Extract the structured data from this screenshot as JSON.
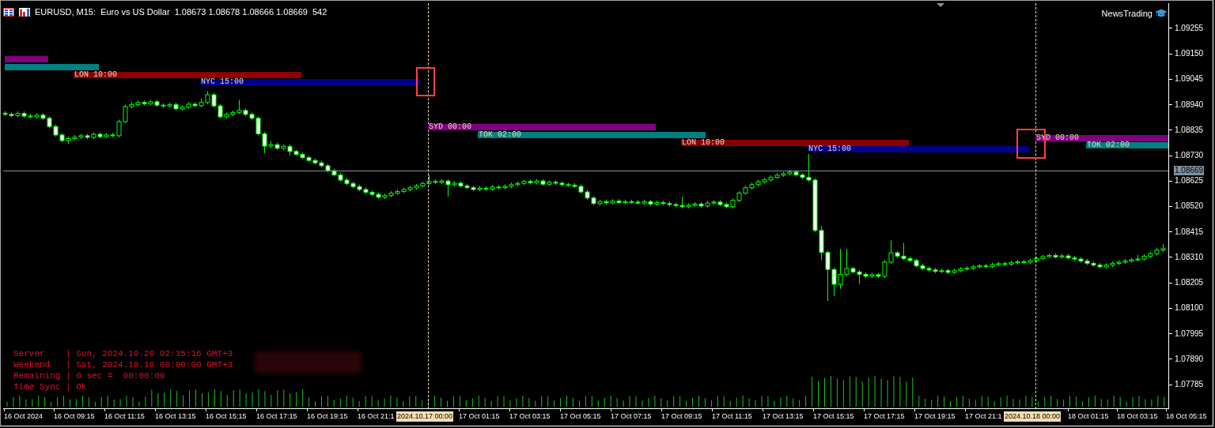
{
  "window": {
    "title": "EURUSD, M15:  Euro vs US Dollar  1.08673 1.08678 1.08666 1.08669  542"
  },
  "indicator": {
    "label": "NewsTrading"
  },
  "chart": {
    "chart_data": {
      "type": "candlestick",
      "ylim": [
        1.07684,
        1.09359
      ],
      "yticks": [
        {
          "value": 1.09255,
          "label": "1.09255"
        },
        {
          "value": 1.0915,
          "label": "1.09150"
        },
        {
          "value": 1.09045,
          "label": "1.09045"
        },
        {
          "value": 1.0894,
          "label": "1.08940"
        },
        {
          "value": 1.08835,
          "label": "1.08835"
        },
        {
          "value": 1.0873,
          "label": "1.08730"
        },
        {
          "value": 1.08625,
          "label": "1.08625"
        },
        {
          "value": 1.0852,
          "label": "1.08520"
        },
        {
          "value": 1.08415,
          "label": "1.08415"
        },
        {
          "value": 1.0831,
          "label": "1.08310"
        },
        {
          "value": 1.08205,
          "label": "1.08205"
        },
        {
          "value": 1.081,
          "label": "1.08100"
        },
        {
          "value": 1.07995,
          "label": "1.07995"
        },
        {
          "value": 1.0789,
          "label": "1.07890"
        },
        {
          "value": 1.07785,
          "label": "1.07785"
        }
      ],
      "categories": [
        null,
        null,
        null,
        null,
        null,
        null,
        null,
        null,
        null,
        null,
        null,
        null,
        null,
        null,
        null,
        null,
        null,
        null,
        null,
        null,
        null,
        null,
        null,
        null,
        null,
        null,
        null,
        null,
        null,
        null,
        null,
        null,
        null,
        null,
        null,
        null,
        null,
        null,
        null,
        null,
        null,
        null,
        null,
        null,
        null,
        null,
        null,
        null,
        null,
        null,
        null,
        null,
        null,
        null,
        null,
        null,
        null,
        null,
        null,
        null,
        null,
        null,
        null,
        null,
        null,
        null,
        null,
        null,
        null,
        null,
        null,
        null,
        null,
        null,
        null,
        null,
        null,
        null,
        null,
        null,
        null,
        null,
        null,
        null,
        null,
        null,
        null,
        null,
        null,
        null,
        null,
        null,
        null,
        null,
        null,
        null,
        null,
        null,
        null,
        null,
        null,
        null,
        null,
        null,
        null,
        null,
        null,
        null,
        null,
        null,
        null,
        null,
        null,
        null,
        null,
        null,
        null,
        null,
        null,
        null,
        null,
        null,
        null,
        null,
        null,
        null,
        null,
        null,
        null,
        null,
        null,
        null,
        null,
        null,
        null,
        null,
        null,
        null,
        null,
        null,
        null,
        null,
        null,
        null,
        null,
        null,
        null,
        null,
        null,
        null,
        null,
        null,
        null,
        null,
        null,
        null,
        null,
        null,
        null,
        null,
        null,
        null,
        null,
        null,
        null,
        null,
        null,
        null,
        null,
        null,
        null,
        null,
        null,
        null,
        null,
        null,
        null,
        null,
        null,
        null,
        null,
        null,
        null,
        null
      ],
      "ohlc": [
        [
          1.08905,
          1.08913,
          1.08893,
          1.089
        ],
        [
          1.089,
          1.08908,
          1.08888,
          1.08895
        ],
        [
          1.08895,
          1.08912,
          1.08888,
          1.08904
        ],
        [
          1.08904,
          1.08912,
          1.08886,
          1.08893
        ],
        [
          1.08893,
          1.08901,
          1.08883,
          1.0889
        ],
        [
          1.0889,
          1.08905,
          1.08883,
          1.08897
        ],
        [
          1.08897,
          1.08905,
          1.08877,
          1.08884
        ],
        [
          1.08884,
          1.08892,
          1.08843,
          1.0885
        ],
        [
          1.0885,
          1.08858,
          1.08808,
          1.08815
        ],
        [
          1.08815,
          1.08823,
          1.08785,
          1.08792
        ],
        [
          1.08792,
          1.08808,
          1.08778,
          1.088
        ],
        [
          1.088,
          1.08814,
          1.08793,
          1.08806
        ],
        [
          1.08806,
          1.0882,
          1.08799,
          1.08812
        ],
        [
          1.08812,
          1.0882,
          1.08798,
          1.08805
        ],
        [
          1.08805,
          1.08826,
          1.08798,
          1.08818
        ],
        [
          1.08818,
          1.08826,
          1.08801,
          1.08808
        ],
        [
          1.08808,
          1.08823,
          1.08801,
          1.08815
        ],
        [
          1.08815,
          1.08823,
          1.08805,
          1.08812
        ],
        [
          1.08812,
          1.08878,
          1.08805,
          1.0887
        ],
        [
          1.0887,
          1.0894,
          1.08863,
          1.08932
        ],
        [
          1.08932,
          1.08952,
          1.08925,
          1.0894
        ],
        [
          1.0894,
          1.08957,
          1.08933,
          1.08949
        ],
        [
          1.08949,
          1.08957,
          1.08937,
          1.08944
        ],
        [
          1.08944,
          1.0896,
          1.08937,
          1.08952
        ],
        [
          1.08952,
          1.0896,
          1.08931,
          1.08938
        ],
        [
          1.08938,
          1.08946,
          1.08928,
          1.08935
        ],
        [
          1.08935,
          1.08948,
          1.08928,
          1.0894
        ],
        [
          1.0894,
          1.08948,
          1.08916,
          1.08923
        ],
        [
          1.08923,
          1.08938,
          1.08916,
          1.0893
        ],
        [
          1.0893,
          1.0895,
          1.08923,
          1.08942
        ],
        [
          1.08942,
          1.0895,
          1.08929,
          1.08936
        ],
        [
          1.08936,
          1.08965,
          1.08929,
          1.08949
        ],
        [
          1.08949,
          1.08995,
          1.08942,
          1.08981
        ],
        [
          1.08981,
          1.08989,
          1.08928,
          1.08935
        ],
        [
          1.08935,
          1.08943,
          1.08883,
          1.0889
        ],
        [
          1.0889,
          1.08908,
          1.08883,
          1.089
        ],
        [
          1.089,
          1.08916,
          1.08893,
          1.08908
        ],
        [
          1.08908,
          1.0896,
          1.08901,
          1.08916
        ],
        [
          1.08916,
          1.08924,
          1.08893,
          1.089
        ],
        [
          1.089,
          1.08908,
          1.08877,
          1.08884
        ],
        [
          1.08884,
          1.08892,
          1.08813,
          1.0882
        ],
        [
          1.0882,
          1.08828,
          1.0874,
          1.08769
        ],
        [
          1.08769,
          1.0879,
          1.0876,
          1.08775
        ],
        [
          1.08775,
          1.08783,
          1.08753,
          1.0876
        ],
        [
          1.0876,
          1.08776,
          1.08753,
          1.08768
        ],
        [
          1.08768,
          1.08776,
          1.0873,
          1.08747
        ],
        [
          1.08747,
          1.08755,
          1.08728,
          1.08735
        ],
        [
          1.08735,
          1.08743,
          1.08715,
          1.08722
        ],
        [
          1.08722,
          1.0873,
          1.08703,
          1.0871
        ],
        [
          1.0871,
          1.08718,
          1.08693,
          1.087
        ],
        [
          1.087,
          1.08708,
          1.08681,
          1.08688
        ],
        [
          1.08688,
          1.08696,
          1.08661,
          1.08668
        ],
        [
          1.08668,
          1.08676,
          1.08643,
          1.0865
        ],
        [
          1.0865,
          1.08658,
          1.08622,
          1.08629
        ],
        [
          1.08629,
          1.08637,
          1.08608,
          1.08615
        ],
        [
          1.08615,
          1.08623,
          1.08595,
          1.08602
        ],
        [
          1.08602,
          1.0861,
          1.08583,
          1.0859
        ],
        [
          1.0859,
          1.08598,
          1.08571,
          1.08578
        ],
        [
          1.08578,
          1.08586,
          1.08563,
          1.0857
        ],
        [
          1.0857,
          1.08578,
          1.08551,
          1.08558
        ],
        [
          1.08558,
          1.08573,
          1.08551,
          1.08565
        ],
        [
          1.08565,
          1.08583,
          1.08558,
          1.08575
        ],
        [
          1.08575,
          1.0859,
          1.08568,
          1.08582
        ],
        [
          1.08582,
          1.08598,
          1.08575,
          1.0859
        ],
        [
          1.0859,
          1.08605,
          1.08583,
          1.08597
        ],
        [
          1.08597,
          1.08613,
          1.0859,
          1.08605
        ],
        [
          1.08605,
          1.08623,
          1.08598,
          1.08615
        ],
        [
          1.08615,
          1.0865,
          1.08608,
          1.08623
        ],
        [
          1.08623,
          1.08631,
          1.08613,
          1.0862
        ],
        [
          1.0862,
          1.08633,
          1.08613,
          1.08625
        ],
        [
          1.08625,
          1.08633,
          1.0856,
          1.0861
        ],
        [
          1.0861,
          1.08624,
          1.08603,
          1.08616
        ],
        [
          1.08616,
          1.08624,
          1.08598,
          1.08605
        ],
        [
          1.08605,
          1.08613,
          1.08591,
          1.08598
        ],
        [
          1.08598,
          1.08606,
          1.08583,
          1.0859
        ],
        [
          1.0859,
          1.08603,
          1.08583,
          1.08595
        ],
        [
          1.08595,
          1.08603,
          1.08585,
          1.08592
        ],
        [
          1.08592,
          1.08608,
          1.08585,
          1.086
        ],
        [
          1.086,
          1.08608,
          1.08591,
          1.08598
        ],
        [
          1.08598,
          1.08611,
          1.08591,
          1.08603
        ],
        [
          1.08603,
          1.08618,
          1.08596,
          1.0861
        ],
        [
          1.0861,
          1.08623,
          1.08603,
          1.08615
        ],
        [
          1.08615,
          1.08631,
          1.08608,
          1.08623
        ],
        [
          1.08623,
          1.08631,
          1.08611,
          1.08618
        ],
        [
          1.08618,
          1.08633,
          1.08611,
          1.08625
        ],
        [
          1.08625,
          1.08633,
          1.08605,
          1.08612
        ],
        [
          1.08612,
          1.08628,
          1.08605,
          1.0862
        ],
        [
          1.0862,
          1.08628,
          1.08609,
          1.08616
        ],
        [
          1.08616,
          1.08624,
          1.08603,
          1.0861
        ],
        [
          1.0861,
          1.08618,
          1.08601,
          1.08608
        ],
        [
          1.08608,
          1.08616,
          1.08596,
          1.08603
        ],
        [
          1.08603,
          1.08611,
          1.08573,
          1.0858
        ],
        [
          1.0858,
          1.08588,
          1.08548,
          1.08555
        ],
        [
          1.08555,
          1.08563,
          1.08525,
          1.08532
        ],
        [
          1.08532,
          1.08548,
          1.08525,
          1.0854
        ],
        [
          1.0854,
          1.08548,
          1.08528,
          1.08535
        ],
        [
          1.08535,
          1.0855,
          1.08528,
          1.08542
        ],
        [
          1.08542,
          1.0855,
          1.08529,
          1.08536
        ],
        [
          1.08536,
          1.08548,
          1.08529,
          1.0854
        ],
        [
          1.0854,
          1.08548,
          1.08531,
          1.08538
        ],
        [
          1.08538,
          1.08546,
          1.08527,
          1.08534
        ],
        [
          1.08534,
          1.08548,
          1.08527,
          1.0854
        ],
        [
          1.0854,
          1.08548,
          1.08523,
          1.0853
        ],
        [
          1.0853,
          1.08544,
          1.08523,
          1.08536
        ],
        [
          1.08536,
          1.08544,
          1.08525,
          1.08532
        ],
        [
          1.08532,
          1.0854,
          1.08521,
          1.08528
        ],
        [
          1.08528,
          1.08536,
          1.08517,
          1.08524
        ],
        [
          1.08524,
          1.0856,
          1.08512,
          1.08519
        ],
        [
          1.08519,
          1.08533,
          1.08512,
          1.08525
        ],
        [
          1.08525,
          1.08538,
          1.08518,
          1.0853
        ],
        [
          1.0853,
          1.08538,
          1.08515,
          1.08522
        ],
        [
          1.08522,
          1.08542,
          1.08515,
          1.08534
        ],
        [
          1.08534,
          1.08546,
          1.08527,
          1.08538
        ],
        [
          1.08538,
          1.08546,
          1.08521,
          1.08528
        ],
        [
          1.08528,
          1.08536,
          1.08512,
          1.08519
        ],
        [
          1.08519,
          1.08553,
          1.08512,
          1.08545
        ],
        [
          1.08545,
          1.08583,
          1.08538,
          1.08575
        ],
        [
          1.08575,
          1.08605,
          1.08568,
          1.08597
        ],
        [
          1.08597,
          1.08618,
          1.0859,
          1.0861
        ],
        [
          1.0861,
          1.0863,
          1.08603,
          1.08622
        ],
        [
          1.08622,
          1.08638,
          1.08615,
          1.0863
        ],
        [
          1.0863,
          1.08648,
          1.08623,
          1.0864
        ],
        [
          1.0864,
          1.08657,
          1.08633,
          1.08649
        ],
        [
          1.08649,
          1.08663,
          1.08642,
          1.08655
        ],
        [
          1.08655,
          1.0867,
          1.08648,
          1.08662
        ],
        [
          1.08662,
          1.0867,
          1.08643,
          1.0865
        ],
        [
          1.0865,
          1.08658,
          1.08633,
          1.0864
        ],
        [
          1.0864,
          1.08737,
          1.08622,
          1.08629
        ],
        [
          1.08629,
          1.08637,
          1.08414,
          1.08421
        ],
        [
          1.08421,
          1.0844,
          1.083,
          1.0833
        ],
        [
          1.0833,
          1.08338,
          1.0813,
          1.0826
        ],
        [
          1.0826,
          1.08268,
          1.0815,
          1.08199
        ],
        [
          1.08199,
          1.08345,
          1.0818,
          1.0824
        ],
        [
          1.0824,
          1.08345,
          1.0823,
          1.08264
        ],
        [
          1.08264,
          1.08272,
          1.08243,
          1.0825
        ],
        [
          1.0825,
          1.08258,
          1.082,
          1.0824
        ],
        [
          1.0824,
          1.08248,
          1.08225,
          1.08232
        ],
        [
          1.08232,
          1.08246,
          1.08225,
          1.08238
        ],
        [
          1.08238,
          1.08246,
          1.08225,
          1.08232
        ],
        [
          1.08232,
          1.08298,
          1.08225,
          1.0829
        ],
        [
          1.0829,
          1.0838,
          1.08283,
          1.08329
        ],
        [
          1.08329,
          1.08337,
          1.08308,
          1.08315
        ],
        [
          1.08315,
          1.0837,
          1.08298,
          1.08305
        ],
        [
          1.08305,
          1.08313,
          1.0829,
          1.08297
        ],
        [
          1.08297,
          1.08305,
          1.08268,
          1.08275
        ],
        [
          1.08275,
          1.08283,
          1.08257,
          1.08264
        ],
        [
          1.08264,
          1.08272,
          1.08251,
          1.08258
        ],
        [
          1.08258,
          1.08266,
          1.08245,
          1.08252
        ],
        [
          1.08252,
          1.08263,
          1.08245,
          1.08255
        ],
        [
          1.08255,
          1.08263,
          1.08241,
          1.08248
        ],
        [
          1.08248,
          1.08263,
          1.08241,
          1.08255
        ],
        [
          1.08255,
          1.0827,
          1.08248,
          1.08262
        ],
        [
          1.08262,
          1.08273,
          1.08255,
          1.08265
        ],
        [
          1.08265,
          1.08279,
          1.08258,
          1.08271
        ],
        [
          1.08271,
          1.08283,
          1.08264,
          1.08275
        ],
        [
          1.08275,
          1.08283,
          1.08265,
          1.08272
        ],
        [
          1.08272,
          1.08288,
          1.08265,
          1.0828
        ],
        [
          1.0828,
          1.08292,
          1.08273,
          1.08284
        ],
        [
          1.08284,
          1.08292,
          1.08275,
          1.08282
        ],
        [
          1.08282,
          1.08296,
          1.08275,
          1.08288
        ],
        [
          1.08288,
          1.083,
          1.08281,
          1.08292
        ],
        [
          1.08292,
          1.083,
          1.08283,
          1.0829
        ],
        [
          1.0829,
          1.08305,
          1.08283,
          1.08297
        ],
        [
          1.08297,
          1.08313,
          1.0829,
          1.08305
        ],
        [
          1.08305,
          1.08321,
          1.08298,
          1.08313
        ],
        [
          1.08313,
          1.08326,
          1.08306,
          1.08318
        ],
        [
          1.08318,
          1.08326,
          1.08305,
          1.08312
        ],
        [
          1.08312,
          1.08324,
          1.08305,
          1.08316
        ],
        [
          1.08316,
          1.08324,
          1.08301,
          1.08308
        ],
        [
          1.08308,
          1.08316,
          1.08296,
          1.08303
        ],
        [
          1.08303,
          1.08311,
          1.08288,
          1.08295
        ],
        [
          1.08295,
          1.08303,
          1.08278,
          1.08285
        ],
        [
          1.08285,
          1.08293,
          1.08271,
          1.08278
        ],
        [
          1.08278,
          1.08286,
          1.08264,
          1.08271
        ],
        [
          1.08271,
          1.08286,
          1.08264,
          1.08278
        ],
        [
          1.08278,
          1.08293,
          1.08271,
          1.08285
        ],
        [
          1.08285,
          1.08298,
          1.08278,
          1.0829
        ],
        [
          1.0829,
          1.08303,
          1.08283,
          1.08295
        ],
        [
          1.08295,
          1.08308,
          1.08288,
          1.083
        ],
        [
          1.083,
          1.0832,
          1.08293,
          1.08303
        ],
        [
          1.08303,
          1.08323,
          1.08296,
          1.08315
        ],
        [
          1.08315,
          1.08333,
          1.08308,
          1.08325
        ],
        [
          1.08325,
          1.0835,
          1.08318,
          1.0834
        ],
        [
          1.0834,
          1.08365,
          1.08333,
          1.08346
        ]
      ]
    }
  },
  "sessions": [
    {
      "color": "#800080"
    },
    {
      "color": "#008080"
    },
    {
      "label": "LON 10:00",
      "color": "#8b0000"
    },
    {
      "label": "NYC 15:00",
      "color": "#00008b"
    },
    {
      "label": "SYD 00:00",
      "color": "#800080"
    },
    {
      "label": "TOK 02:00",
      "color": "#008080"
    },
    {
      "label": "LON 10:00",
      "color": "#8b0000"
    },
    {
      "label": "NYC 15:00",
      "color": "#00008b"
    },
    {
      "label": "SYD 00:00",
      "color": "#800080"
    },
    {
      "label": "TOK 02:00",
      "color": "#008080"
    }
  ],
  "current_price": {
    "label": "1.08669"
  },
  "info_panel": [
    "Server    | Sun, 2024.10.20 02:35:16 GMT+3",
    "Weekend   | Sat, 2024.10.19 00:00:00 GMT+3",
    "Remaining | 0 sec =  00:00:00",
    "Time Sync | Ok"
  ],
  "time_axis": [
    {
      "label": "16 Oct 2024",
      "selected": false
    },
    {
      "label": "16 Oct 09:15",
      "selected": false
    },
    {
      "label": "16 Oct 11:15",
      "selected": false
    },
    {
      "label": "16 Oct 13:15",
      "selected": false
    },
    {
      "label": "16 Oct 15:15",
      "selected": false
    },
    {
      "label": "16 Oct 17:15",
      "selected": false
    },
    {
      "label": "16 Oct 19:15",
      "selected": false
    },
    {
      "label": "16 Oct 21:1",
      "selected": false
    },
    {
      "label": "2024.10.17 00:00",
      "selected": true
    },
    {
      "label": "17 Oct 01:15",
      "selected": false
    },
    {
      "label": "17 Oct 03:15",
      "selected": false
    },
    {
      "label": "17 Oct 05:15",
      "selected": false
    },
    {
      "label": "17 Oct 07:15",
      "selected": false
    },
    {
      "label": "17 Oct 09:15",
      "selected": false
    },
    {
      "label": "17 Oct 11:15",
      "selected": false
    },
    {
      "label": "17 Oct 13:15",
      "selected": false
    },
    {
      "label": "17 Oct 15:15",
      "selected": false
    },
    {
      "label": "17 Oct 17:15",
      "selected": false
    },
    {
      "label": "17 Oct 19:15",
      "selected": false
    },
    {
      "label": "17 Oct 21:1",
      "selected": false
    },
    {
      "label": "2024.10.18 00:00",
      "selected": true
    },
    {
      "label": "18 Oct 01:15",
      "selected": false
    },
    {
      "label": "18 Oct 03:15",
      "selected": false
    },
    {
      "label": "18 Oct 05:15",
      "selected": false
    }
  ]
}
